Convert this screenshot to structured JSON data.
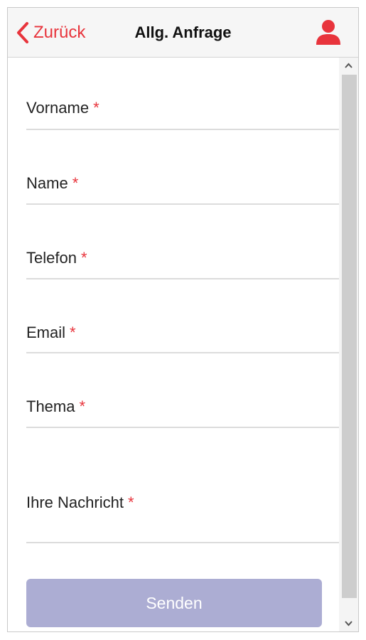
{
  "header": {
    "back_label": "Zurück",
    "title": "Allg. Anfrage"
  },
  "form": {
    "required_marker": "*",
    "fields": [
      {
        "label": "Vorname"
      },
      {
        "label": "Name"
      },
      {
        "label": "Telefon"
      },
      {
        "label": "Email"
      },
      {
        "label": "Thema"
      },
      {
        "label": "Ihre Nachricht"
      }
    ],
    "submit_label": "Senden"
  },
  "colors": {
    "accent": "#e8343c",
    "submit_bg": "#acadd3",
    "header_bg": "#f6f6f6"
  },
  "icons": {
    "back": "chevron-left-icon",
    "user": "user-icon",
    "scroll_up": "chevron-up-icon",
    "scroll_down": "chevron-down-icon"
  }
}
